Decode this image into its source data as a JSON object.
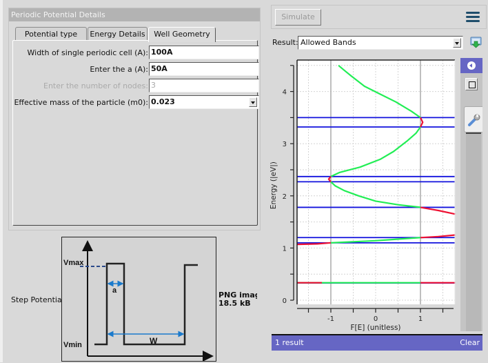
{
  "left_panel": {
    "title": "Periodic Potential Details",
    "tabs": [
      {
        "label": "Potential type",
        "active": false
      },
      {
        "label": "Energy Details",
        "active": false
      },
      {
        "label": "Well Geometry",
        "active": true
      }
    ],
    "fields": [
      {
        "label": "Width of single periodic cell (A):",
        "value": "100A",
        "disabled": false,
        "type": "text"
      },
      {
        "label": "Enter the a (A):",
        "value": "50A",
        "disabled": false,
        "type": "text"
      },
      {
        "label": "Enter the number of nodes:",
        "value": "3",
        "disabled": true,
        "type": "text"
      },
      {
        "label": "Effective mass of the particle (m0):",
        "value": "0.023",
        "disabled": false,
        "type": "select"
      }
    ]
  },
  "step_potential": {
    "label": "Step Potential:",
    "image_labels": {
      "vmax": "Vmax",
      "vmin": "Vmin",
      "a": "a",
      "w": "W"
    },
    "png_info": [
      "PNG image",
      "18.5 kB"
    ]
  },
  "toolbar": {
    "simulate_label": "Simulate",
    "menu_icon": "hamburger-menu-icon"
  },
  "result": {
    "label": "Result:",
    "selected": "Allowed Bands",
    "download_icon": "download-icon"
  },
  "side_tools": {
    "collapse_icon": "chevron-left-circle-icon",
    "square_icon": "square-icon",
    "wrench_icon": "wrench-icon"
  },
  "status_bar": {
    "count": "1 result",
    "clear_label": "Clear"
  },
  "colors": {
    "allowed": "#22ee55",
    "forbidden": "#ee1133",
    "band_edge": "#1111dd",
    "accent": "#6666c4"
  },
  "chart_data": {
    "type": "line",
    "title": "",
    "xlabel": "F[E] (unitless)",
    "ylabel": "Energy (|eV|)",
    "xlim": [
      -1.75,
      1.78
    ],
    "ylim": [
      0,
      4.55
    ],
    "xticks": [
      -1.5,
      -1,
      -0.5,
      0,
      0.5,
      1,
      1.5
    ],
    "xtick_labels": {
      "-1": "-1",
      "0": "0",
      "1": "1"
    },
    "yticks": [
      0,
      0.5,
      1,
      1.5,
      2,
      2.5,
      3,
      3.5,
      4,
      4.5
    ],
    "ytick_labels": {
      "0": "0",
      "1": "1",
      "2": "2",
      "3": "3",
      "4": "4"
    },
    "grid": true,
    "reference_lines_x": [
      -1,
      1
    ],
    "band_edges": [
      0.33,
      1.1,
      1.2,
      1.78,
      2.27,
      2.37,
      3.32,
      3.5
    ],
    "series": [
      {
        "name": "allowed",
        "color": "allowed",
        "segments": [
          [
            [
              -1.8,
              0.335
            ],
            [
              1.0,
              0.335
            ]
          ],
          [
            [
              -1.0,
              1.1
            ],
            [
              -0.5,
              1.12
            ],
            [
              0.0,
              1.14
            ],
            [
              0.5,
              1.17
            ],
            [
              1.0,
              1.2
            ]
          ],
          [
            [
              1.0,
              1.78
            ],
            [
              0.5,
              1.83
            ],
            [
              0.0,
              1.9
            ],
            [
              -0.38,
              2.0
            ],
            [
              -0.7,
              2.1
            ],
            [
              -0.9,
              2.19
            ],
            [
              -1.0,
              2.27
            ]
          ],
          [
            [
              -1.0,
              2.37
            ],
            [
              -0.8,
              2.45
            ],
            [
              -0.35,
              2.55
            ],
            [
              0.1,
              2.7
            ],
            [
              0.4,
              2.85
            ],
            [
              0.7,
              3.05
            ],
            [
              0.9,
              3.2
            ],
            [
              1.0,
              3.32
            ]
          ],
          [
            [
              1.0,
              3.5
            ],
            [
              0.8,
              3.62
            ],
            [
              0.45,
              3.8
            ],
            [
              0.1,
              3.95
            ],
            [
              -0.25,
              4.1
            ],
            [
              -0.55,
              4.3
            ],
            [
              -0.72,
              4.42
            ],
            [
              -0.83,
              4.5
            ]
          ]
        ]
      },
      {
        "name": "forbidden",
        "color": "forbidden",
        "segments": [
          [
            [
              -1.75,
              0.335
            ],
            [
              -1.2,
              0.335
            ]
          ],
          [
            [
              1.0,
              0.335
            ],
            [
              1.78,
              0.335
            ]
          ],
          [
            [
              -1.75,
              1.07
            ],
            [
              -1.3,
              1.08
            ],
            [
              -1.0,
              1.1
            ]
          ],
          [
            [
              1.0,
              1.2
            ],
            [
              1.4,
              1.22
            ],
            [
              1.78,
              1.25
            ]
          ],
          [
            [
              1.0,
              1.78
            ],
            [
              1.4,
              1.72
            ],
            [
              1.78,
              1.65
            ]
          ],
          [
            [
              -1.0,
              2.27
            ],
            [
              -1.05,
              2.32
            ],
            [
              -1.0,
              2.37
            ]
          ],
          [
            [
              1.0,
              3.32
            ],
            [
              1.05,
              3.41
            ],
            [
              1.0,
              3.5
            ]
          ]
        ]
      }
    ]
  }
}
